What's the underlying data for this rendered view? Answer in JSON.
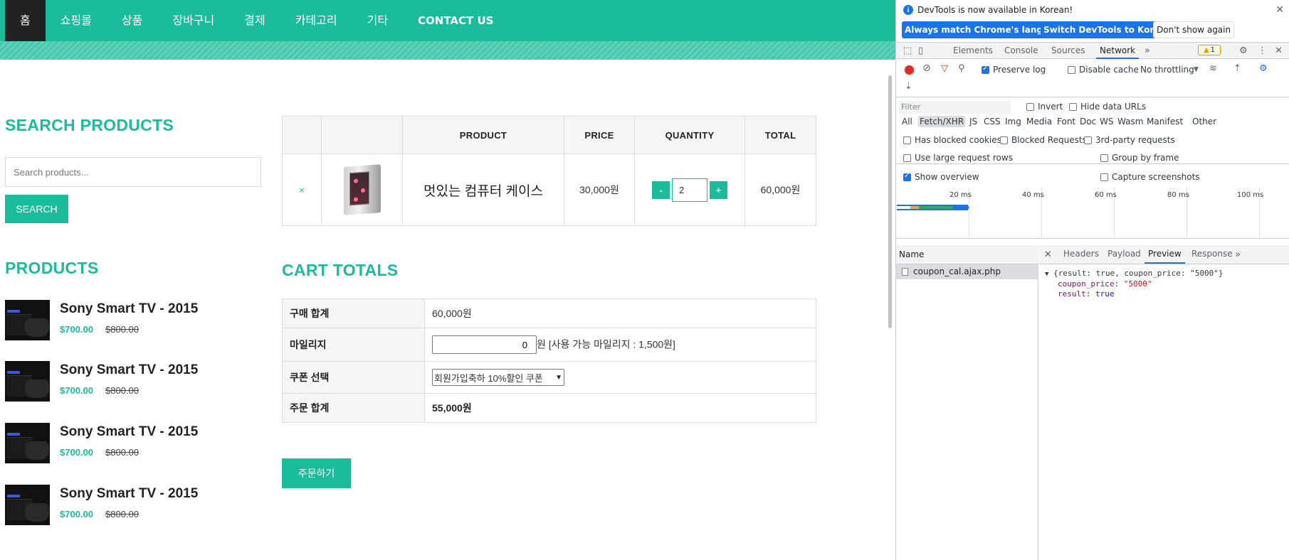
{
  "nav": {
    "items": [
      "홈",
      "쇼핑몰",
      "상품",
      "장바구니",
      "결제",
      "카테고리",
      "기타",
      "CONTACT US"
    ]
  },
  "sidebar": {
    "search_title": "SEARCH PRODUCTS",
    "search_placeholder": "Search products...",
    "search_button": "SEARCH",
    "products_title": "PRODUCTS",
    "products": [
      {
        "name": "Sony Smart TV - 2015",
        "price": "$700.00",
        "old_price": "$800.00"
      },
      {
        "name": "Sony Smart TV - 2015",
        "price": "$700.00",
        "old_price": "$800.00"
      },
      {
        "name": "Sony Smart TV - 2015",
        "price": "$700.00",
        "old_price": "$800.00"
      },
      {
        "name": "Sony Smart TV - 2015",
        "price": "$700.00",
        "old_price": "$800.00"
      }
    ]
  },
  "cart": {
    "headers": [
      "",
      "",
      "PRODUCT",
      "PRICE",
      "QUANTITY",
      "TOTAL"
    ],
    "row": {
      "remove": "×",
      "product": "멋있는 컴퓨터 케이스",
      "price": "30,000원",
      "quantity": "2",
      "minus": "-",
      "plus": "+",
      "total": "60,000원"
    }
  },
  "totals": {
    "title": "CART TOTALS",
    "purchase_label": "구매 합계",
    "purchase_value": "60,000원",
    "mileage_label": "마일리지",
    "mileage_value": "0",
    "mileage_unit": "원 [사용 가능 마일리지 : 1,500원]",
    "coupon_label": "쿠폰 선택",
    "coupon_value": "회원가입축하 10%할인 쿠폰",
    "order_label": "주문 합계",
    "order_value": "55,000원",
    "order_button": "주문하기"
  },
  "devtools": {
    "banner": {
      "text": "DevTools is now available in Korean!",
      "btn_match": "Always match Chrome's language",
      "btn_switch": "Switch DevTools to Korean",
      "btn_dismiss": "Don't show again"
    },
    "tabs": [
      "Elements",
      "Console",
      "Sources",
      "Network"
    ],
    "active_tab": "Network",
    "warning_count": "1",
    "toolbar": {
      "preserve_log": "Preserve log",
      "disable_cache": "Disable cache",
      "throttling": "No throttling"
    },
    "filter": {
      "placeholder": "Filter",
      "invert": "Invert",
      "hide_data_urls": "Hide data URLs",
      "types": [
        "All",
        "Fetch/XHR",
        "JS",
        "CSS",
        "Img",
        "Media",
        "Font",
        "Doc",
        "WS",
        "Wasm",
        "Manifest",
        "Other"
      ],
      "has_blocked_cookies": "Has blocked cookies",
      "blocked_requests": "Blocked Requests",
      "third_party": "3rd-party requests",
      "large_rows": "Use large request rows",
      "group_by_frame": "Group by frame",
      "show_overview": "Show overview",
      "capture_screenshots": "Capture screenshots"
    },
    "timeline_labels": [
      "20 ms",
      "40 ms",
      "60 ms",
      "80 ms",
      "100 ms"
    ],
    "requests": {
      "header": "Name",
      "items": [
        "coupon_cal.ajax.php"
      ]
    },
    "detail": {
      "tabs": [
        "Headers",
        "Payload",
        "Preview",
        "Response"
      ],
      "active_tab": "Preview",
      "summary": "{result: true, coupon_price: \"5000\"}",
      "fields": [
        {
          "key": "coupon_price",
          "value": "\"5000\""
        },
        {
          "key": "result",
          "value": "true"
        }
      ]
    }
  },
  "colors": {
    "accent": "#1abc9c",
    "nav_active": "#222222",
    "devtools_blue": "#1a73e8"
  }
}
